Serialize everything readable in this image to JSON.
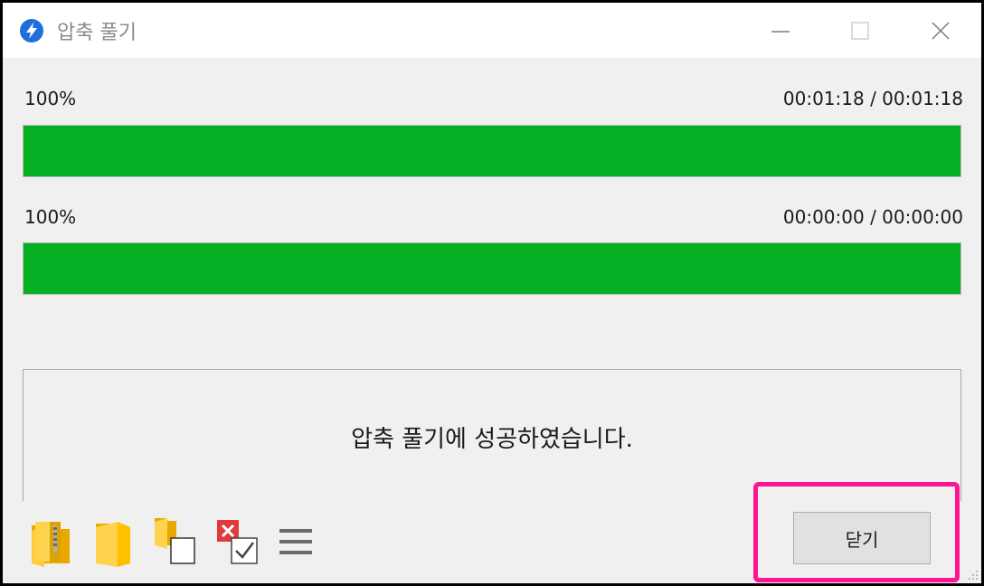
{
  "window": {
    "title": "압축 풀기",
    "icon": "lightning-bolt-icon",
    "controls": [
      "minimize-icon",
      "maximize-icon",
      "close-icon"
    ]
  },
  "progress": [
    {
      "percent_label": "100%",
      "time_label": "00:01:18 / 00:01:18",
      "value": 1.0
    },
    {
      "percent_label": "100%",
      "time_label": "00:00:00 / 00:00:00",
      "value": 1.0
    }
  ],
  "message": "압축 풀기에 성공하였습니다.",
  "toolbar": {
    "icons": [
      "zip-folder-icon",
      "open-folder-icon",
      "copy-icon",
      "delete-checked-icon",
      "menu-icon"
    ]
  },
  "close_button_label": "닫기",
  "colors": {
    "progress_fill": "#06b025",
    "highlight": "#ff1493",
    "app_icon": "#1e6fd9"
  }
}
